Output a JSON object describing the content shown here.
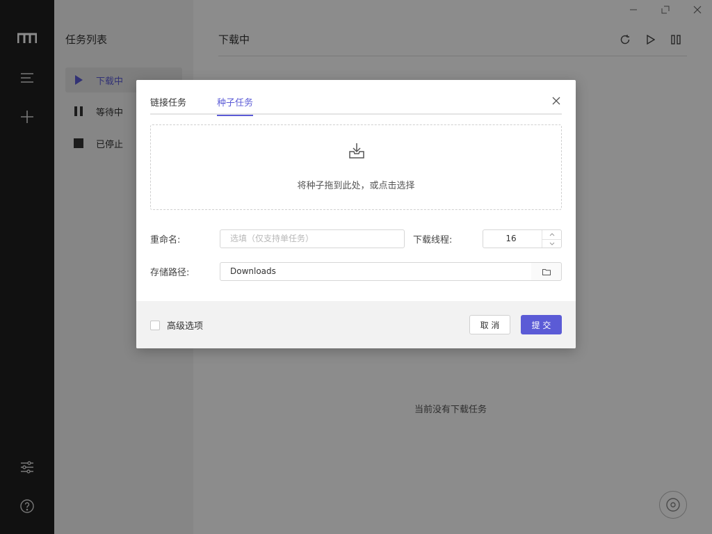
{
  "app": {
    "side_title": "任务列表",
    "side_items": [
      {
        "label": "下载中",
        "icon": "play-icon"
      },
      {
        "label": "等待中",
        "icon": "pause-icon"
      },
      {
        "label": "已停止",
        "icon": "stop-icon"
      }
    ],
    "main_title": "下载中",
    "empty_text": "当前没有下载任务"
  },
  "dialog": {
    "tabs": [
      {
        "label": "链接任务",
        "active": false
      },
      {
        "label": "种子任务",
        "active": true
      }
    ],
    "drop_text": "将种子拖到此处，或点击选择",
    "rename_label": "重命名:",
    "rename_placeholder": "选填（仅支持单任务）",
    "threads_label": "下载线程:",
    "threads_value": "16",
    "path_label": "存储路径:",
    "path_value": "Downloads",
    "advanced_label": "高级选项",
    "cancel_label": "取 消",
    "submit_label": "提 交"
  },
  "colors": {
    "accent": "#5b5bd6",
    "rail": "#1f1f1f"
  }
}
